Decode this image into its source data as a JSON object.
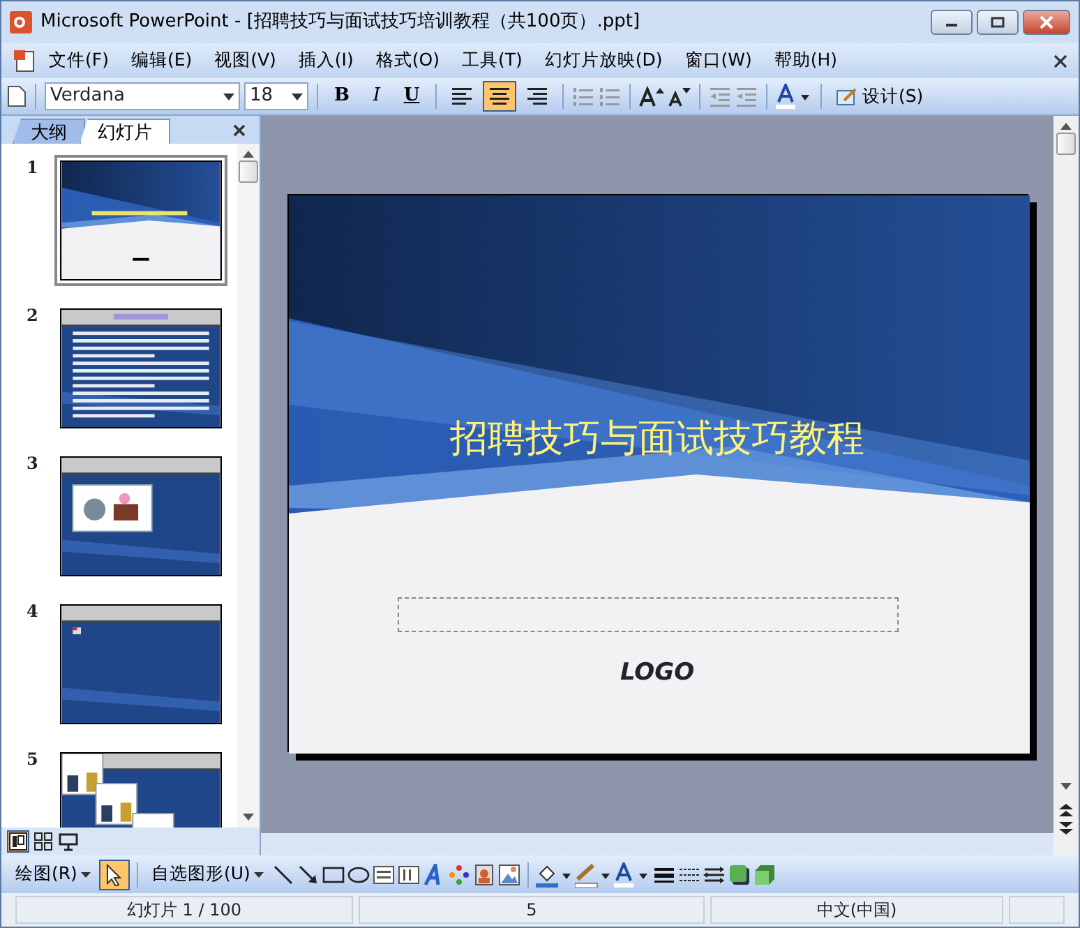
{
  "window": {
    "title": "Microsoft PowerPoint - [招聘技巧与面试技巧培训教程（共100页）.ppt]"
  },
  "menu": [
    "文件(F)",
    "编辑(E)",
    "视图(V)",
    "插入(I)",
    "格式(O)",
    "工具(T)",
    "幻灯片放映(D)",
    "窗口(W)",
    "帮助(H)"
  ],
  "toolbar": {
    "font": "Verdana",
    "size": "18",
    "styles": [
      {
        "kind": "bold",
        "label": "B"
      },
      {
        "kind": "italic",
        "label": "I"
      },
      {
        "kind": "underline",
        "label": "U"
      }
    ],
    "align": [
      {
        "kind": "left",
        "selected": false
      },
      {
        "kind": "center",
        "selected": true
      },
      {
        "kind": "right",
        "selected": false
      }
    ],
    "design": "设计(S)"
  },
  "pane_tabs": [
    {
      "label": "大纲",
      "selected": false
    },
    {
      "label": "幻灯片",
      "selected": true
    }
  ],
  "slides": [
    {
      "number": "1",
      "selected": true,
      "kind": "title"
    },
    {
      "number": "2",
      "selected": false,
      "kind": "text"
    },
    {
      "number": "3",
      "selected": false,
      "kind": "picture"
    },
    {
      "number": "4",
      "selected": false,
      "kind": "blank"
    },
    {
      "number": "5",
      "selected": false,
      "kind": "comic"
    }
  ],
  "slide": {
    "title": "招聘技巧与面试技巧教程",
    "logo": "LOGO"
  },
  "views": [
    {
      "kind": "normal",
      "selected": true
    },
    {
      "kind": "sorter",
      "selected": false
    },
    {
      "kind": "show",
      "selected": false
    }
  ],
  "drawing_toolbar": {
    "draw": "绘图(R)",
    "select_selected": true,
    "autoshapes": "自选图形(U)"
  },
  "status": [
    "幻灯片 1 / 100",
    "5",
    "中文(中国)"
  ]
}
